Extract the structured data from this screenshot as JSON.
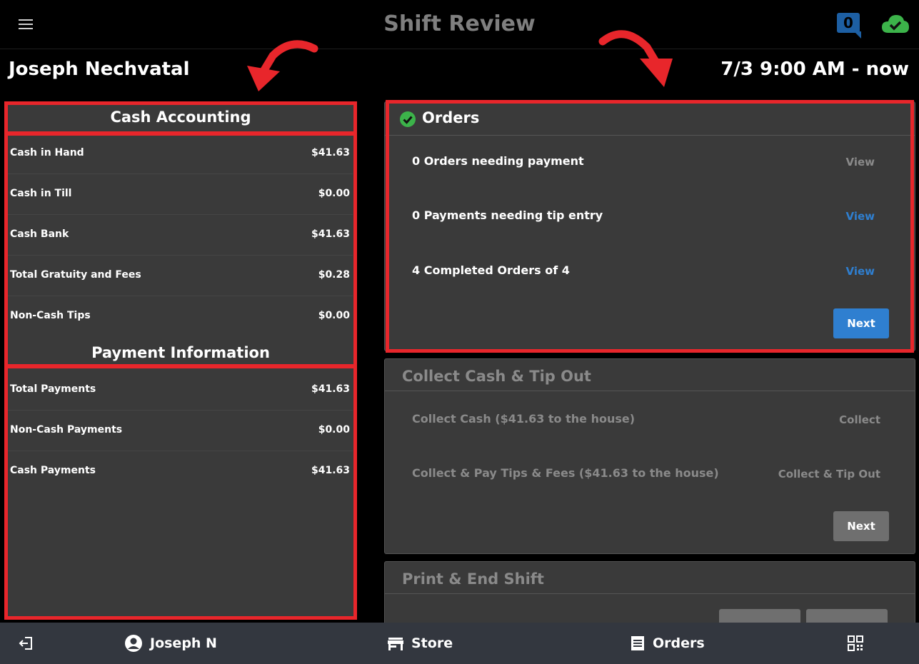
{
  "header": {
    "title": "Shift Review",
    "notification_count": "0",
    "employee_name": "Joseph Nechvatal",
    "shift_range": "7/3 9:00 AM - now"
  },
  "cash_accounting": {
    "title": "Cash Accounting",
    "rows": [
      {
        "label": "Cash in Hand",
        "value": "$41.63"
      },
      {
        "label": "Cash in Till",
        "value": "$0.00"
      },
      {
        "label": "Cash Bank",
        "value": "$41.63"
      },
      {
        "label": "Total Gratuity and Fees",
        "value": "$0.28"
      },
      {
        "label": "Non-Cash Tips",
        "value": "$0.00"
      }
    ]
  },
  "payment_information": {
    "title": "Payment Information",
    "rows": [
      {
        "label": "Total Payments",
        "value": "$41.63"
      },
      {
        "label": "Non-Cash Payments",
        "value": "$0.00"
      },
      {
        "label": "Cash Payments",
        "value": "$41.63"
      }
    ]
  },
  "orders_card": {
    "title": "Orders",
    "rows": [
      {
        "label": "0 Orders needing payment",
        "action": "View"
      },
      {
        "label": "0 Payments needing tip entry",
        "action": "View"
      },
      {
        "label": "4 Completed Orders of 4",
        "action": "View"
      }
    ],
    "next_label": "Next"
  },
  "collect_card": {
    "title": "Collect Cash & Tip Out",
    "rows": [
      {
        "label": "Collect Cash ($41.63 to the house)",
        "action": "Collect"
      },
      {
        "label": "Collect & Pay Tips & Fees ($41.63 to the house)",
        "action": "Collect & Tip Out"
      }
    ],
    "next_label": "Next"
  },
  "print_card": {
    "title": "Print & End Shift"
  },
  "bottom_nav": {
    "user": "Joseph N",
    "store": "Store",
    "orders": "Orders"
  },
  "colors": {
    "accent_blue": "#2f7fd0",
    "check_green": "#3cb34a",
    "highlight_red": "#e8262b",
    "panel_gray": "#3a3a3a"
  }
}
